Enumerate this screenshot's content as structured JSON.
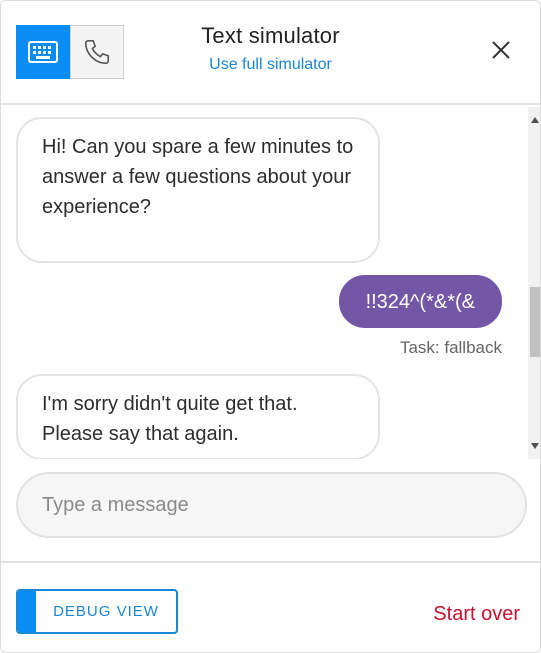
{
  "header": {
    "title": "Text simulator",
    "subtitle": "Use full simulator",
    "modes": [
      {
        "name": "keyboard-icon",
        "active": true
      },
      {
        "name": "phone-icon",
        "active": false
      }
    ],
    "close_icon": "close-icon"
  },
  "messages": [
    {
      "from": "bot",
      "text": "Hi! Can you spare a few minutes to answer a few questions about your experience?"
    },
    {
      "from": "user",
      "text": "!!324^(*&*(&",
      "task": "Task: fallback"
    },
    {
      "from": "bot",
      "text": "I'm sorry didn't quite get that. Please say that again."
    }
  ],
  "input": {
    "placeholder": "Type a message",
    "value": ""
  },
  "footer": {
    "debug_label": "DEBUG VIEW",
    "start_over_label": "Start over"
  },
  "colors": {
    "accent_blue": "#0a8cf5",
    "link_blue": "#1a86d6",
    "user_bubble": "#7357a6",
    "start_over_red": "#c8102e"
  }
}
